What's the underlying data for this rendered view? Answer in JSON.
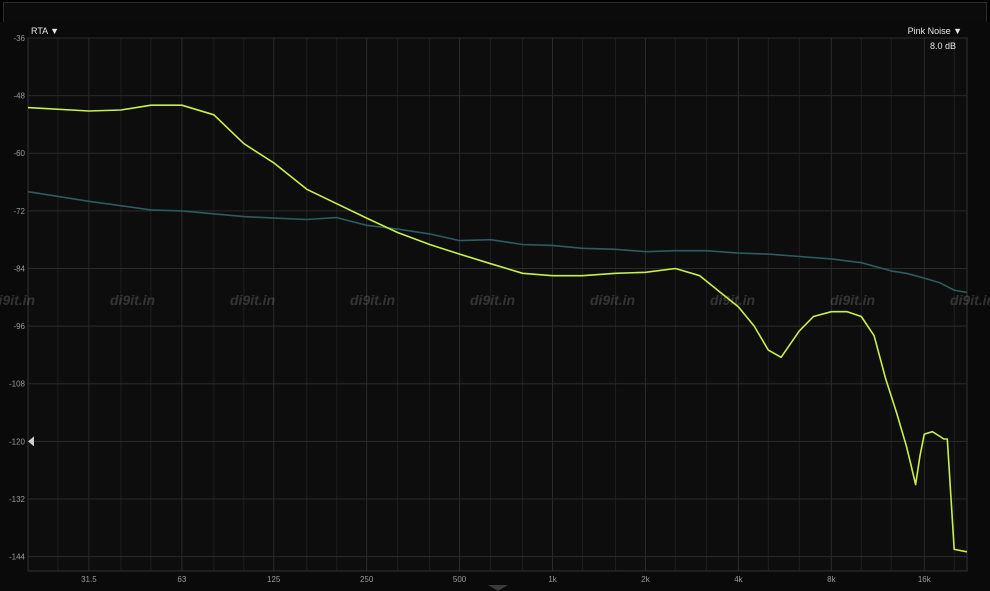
{
  "controls": {
    "analyzer_mode": "RTA ▼",
    "source_select": "Pink Noise ▼",
    "gain_readout": "8.0 dB"
  },
  "watermark": "di9it.in",
  "colors": {
    "background": "#0d0d0d",
    "grid": "#2b2b2b",
    "series_bright": "#c9f04a",
    "series_dark": "#2f5a5e"
  },
  "chart_data": {
    "type": "line",
    "title": "",
    "xlabel": "",
    "ylabel": "",
    "xscale": "log",
    "xlim": [
      20,
      22000
    ],
    "ylim": [
      -147,
      -36
    ],
    "grid": true,
    "x_ticks": [
      31.5,
      63,
      125,
      250,
      500,
      1000,
      2000,
      4000,
      8000,
      16000
    ],
    "x_tick_labels": [
      "31.5",
      "63",
      "125",
      "250",
      "500",
      "1k",
      "2k",
      "4k",
      "8k",
      "16k"
    ],
    "y_ticks": [
      -36,
      -48,
      -60,
      -72,
      -84,
      -96,
      -108,
      -120,
      -132,
      -144
    ],
    "y_tick_labels": [
      "-36",
      "-48",
      "-60",
      "-72",
      "-84",
      "-96",
      "-108",
      "-120",
      "-132",
      "-144"
    ],
    "series": [
      {
        "color": "#2f5a5e",
        "x": [
          20,
          31.5,
          50,
          63,
          100,
          125,
          160,
          200,
          250,
          315,
          400,
          500,
          630,
          800,
          1000,
          1250,
          1600,
          2000,
          2500,
          3150,
          4000,
          5000,
          6300,
          8000,
          10000,
          12500,
          14000,
          16000,
          18000,
          20000,
          22000
        ],
        "y": [
          -68.0,
          -70.0,
          -71.8,
          -72.0,
          -73.2,
          -73.5,
          -73.8,
          -73.4,
          -75.0,
          -75.8,
          -76.8,
          -78.2,
          -78.0,
          -79.0,
          -79.2,
          -79.8,
          -80.0,
          -80.5,
          -80.3,
          -80.3,
          -80.8,
          -81.0,
          -81.5,
          -82.0,
          -82.8,
          -84.5,
          -85.0,
          -86.0,
          -87.0,
          -88.5,
          -89.0
        ]
      },
      {
        "color": "#c9f04a",
        "x": [
          20,
          31.5,
          40,
          50,
          63,
          80,
          100,
          125,
          160,
          200,
          250,
          315,
          400,
          500,
          630,
          800,
          1000,
          1250,
          1600,
          2000,
          2500,
          3000,
          3500,
          4000,
          4500,
          5000,
          5500,
          6300,
          7000,
          8000,
          9000,
          10000,
          11000,
          12000,
          13000,
          14000,
          14500,
          15000,
          15500,
          16000,
          17000,
          18000,
          18500,
          19000,
          20000,
          22000
        ],
        "y": [
          -50.5,
          -51.2,
          -51.0,
          -50.0,
          -50.0,
          -52.0,
          -58.0,
          -62.0,
          -67.5,
          -70.5,
          -73.5,
          -76.5,
          -79.0,
          -81.0,
          -83.0,
          -85.0,
          -85.5,
          -85.5,
          -85.0,
          -84.8,
          -84.0,
          -85.5,
          -89.0,
          -92.0,
          -96.0,
          -101.0,
          -102.5,
          -97.0,
          -94.0,
          -93.0,
          -93.0,
          -94.0,
          -98.0,
          -107.0,
          -114.0,
          -121.0,
          -125.0,
          -129.0,
          -123.0,
          -118.5,
          -118.0,
          -119.0,
          -119.5,
          -119.5,
          -142.5,
          -143.0
        ]
      }
    ]
  }
}
